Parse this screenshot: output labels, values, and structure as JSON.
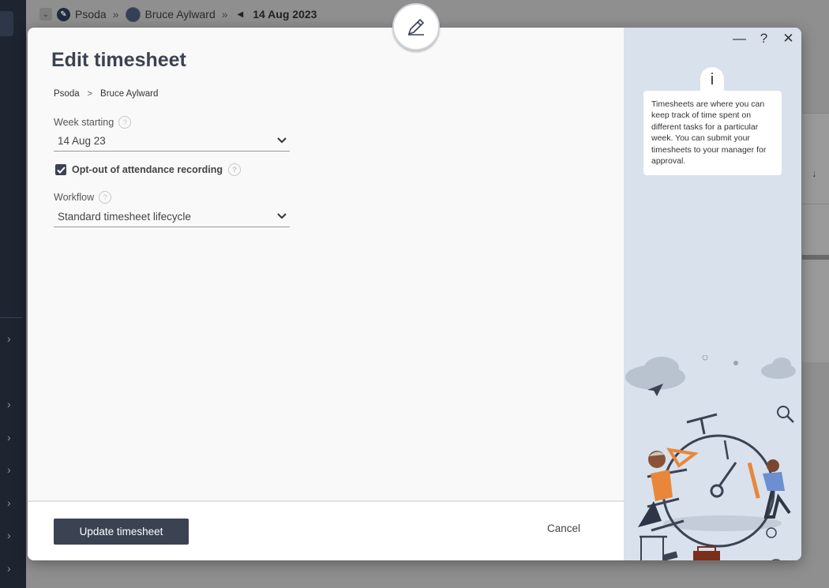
{
  "background": {
    "breadcrumb": {
      "org": "Psoda",
      "user": "Bruce Aylward",
      "date": "14 Aug 2023"
    }
  },
  "modal": {
    "title": "Edit timesheet",
    "breadcrumb": [
      "Psoda",
      "Bruce Aylward"
    ],
    "week_starting": {
      "label": "Week starting",
      "value": "14 Aug 23"
    },
    "opt_out": {
      "label": "Opt-out of attendance recording",
      "checked": true
    },
    "workflow": {
      "label": "Workflow",
      "value": "Standard timesheet lifecycle"
    },
    "buttons": {
      "update": "Update timesheet",
      "cancel": "Cancel"
    },
    "window_controls": {
      "minimize": "—",
      "help": "?",
      "close": "✕"
    },
    "info": {
      "icon_text": "i",
      "text": "Timesheets are where you can keep track of time spent on different tasks for a particular week. You can submit your timesheets to your manager for approval."
    }
  },
  "colors": {
    "accent": "#3b4252",
    "side_panel": "#d8e1ec",
    "illustration_orange": "#e8873a"
  }
}
